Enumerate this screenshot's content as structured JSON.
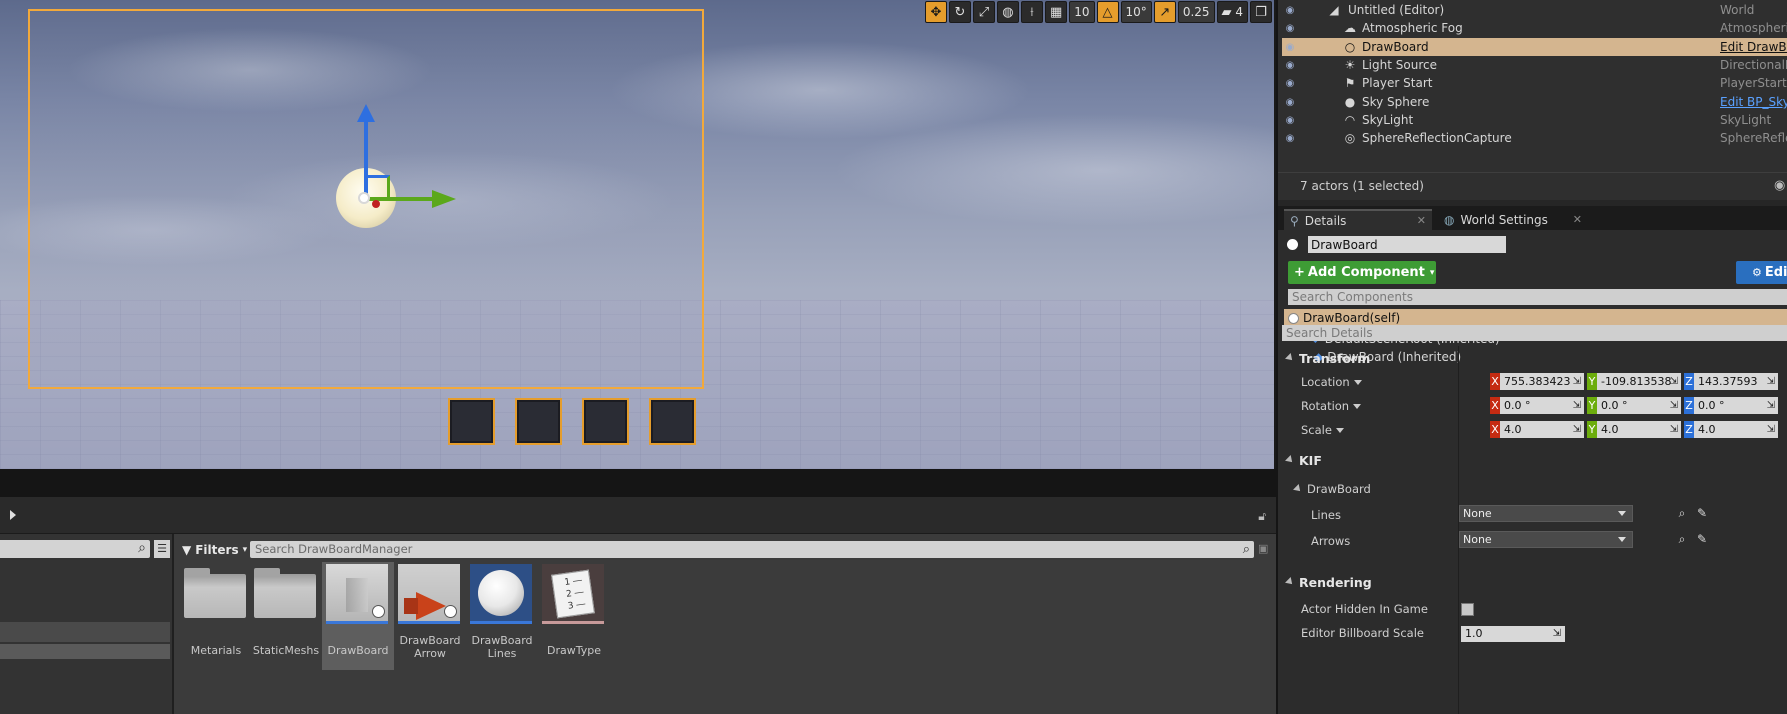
{
  "viewport": {
    "toolbar": {
      "grid_snap": "10",
      "rotation_snap": "10°",
      "scale_snap": "0.25",
      "camera_speed": "4"
    }
  },
  "content_browser": {
    "filters_label": "Filters",
    "search_placeholder": "Search DrawBoardManager",
    "assets": [
      {
        "label": "Metarials",
        "type": "folder"
      },
      {
        "label": "StaticMeshs",
        "type": "folder"
      },
      {
        "label": "DrawBoard",
        "type": "blueprint",
        "selected": true
      },
      {
        "label": "DrawBoard Arrow",
        "type": "blueprint"
      },
      {
        "label": "DrawBoard Lines",
        "type": "blueprint"
      },
      {
        "label": "DrawType",
        "type": "enum"
      }
    ]
  },
  "outliner": {
    "rows": [
      {
        "name": "Untitled (Editor)",
        "type": "World",
        "icon": "world-icon"
      },
      {
        "name": "Atmospheric Fog",
        "type": "AtmosphericFog",
        "icon": "fog-icon"
      },
      {
        "name": "DrawBoard",
        "type": "Edit DrawBoard",
        "icon": "blueprint-icon",
        "selected": true,
        "link": true
      },
      {
        "name": "Light Source",
        "type": "DirectionalLight",
        "icon": "sun-icon"
      },
      {
        "name": "Player Start",
        "type": "PlayerStart",
        "icon": "player-start-icon"
      },
      {
        "name": "Sky Sphere",
        "type": "Edit BP_Sky_Sphere",
        "icon": "sphere-icon",
        "link": true
      },
      {
        "name": "SkyLight",
        "type": "SkyLight",
        "icon": "skylight-icon"
      },
      {
        "name": "SphereReflectionCapture",
        "type": "SphereReflectionCapture",
        "icon": "reflection-icon"
      }
    ],
    "footer": "7 actors (1 selected)"
  },
  "tabs": [
    {
      "label": "Details",
      "active": true
    },
    {
      "label": "World Settings",
      "active": false
    }
  ],
  "details": {
    "actor_name": "DrawBoard",
    "add_component_label": "Add Component",
    "edit_blueprint_label": "Edi",
    "search_components_placeholder": "Search Components",
    "components": {
      "self": "DrawBoard(self)",
      "root": "DefaultSceneRoot (Inherited)",
      "child": "DrawBoard (Inherited)"
    },
    "search_details_placeholder": "Search Details",
    "transform": {
      "label": "Transform",
      "location_label": "Location",
      "rotation_label": "Rotation",
      "scale_label": "Scale",
      "location": {
        "x": "755.383423",
        "y": "-109.813538",
        "z": "143.37593"
      },
      "rotation": {
        "x": "0.0 °",
        "y": "0.0 °",
        "z": "0.0 °"
      },
      "scale": {
        "x": "4.0",
        "y": "4.0",
        "z": "4.0"
      }
    },
    "kif": {
      "label": "KIF",
      "sub_label": "DrawBoard",
      "lines_label": "Lines",
      "lines_value": "None",
      "arrows_label": "Arrows",
      "arrows_value": "None"
    },
    "rendering": {
      "label": "Rendering",
      "hidden_label": "Actor Hidden In Game",
      "billboard_label": "Editor Billboard Scale",
      "billboard_value": "1.0"
    }
  }
}
